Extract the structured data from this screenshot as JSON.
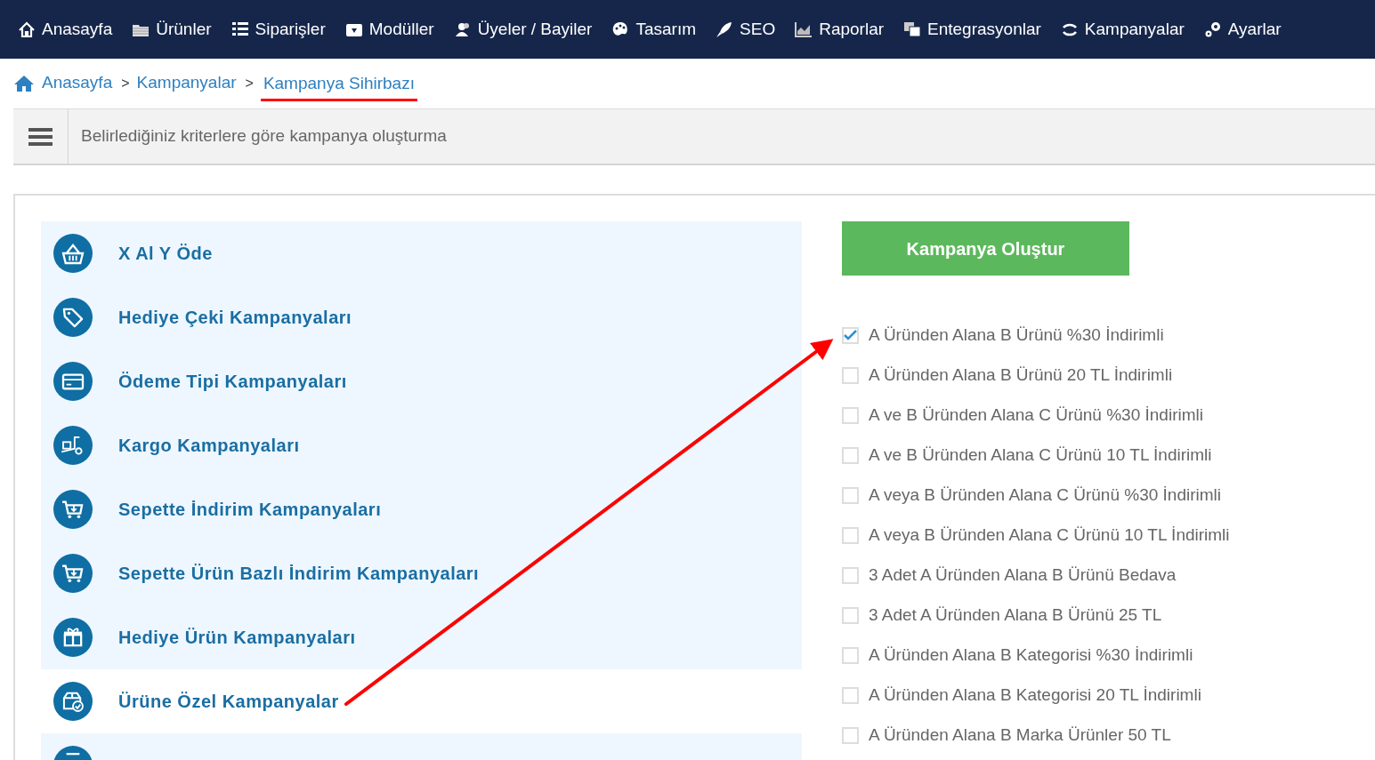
{
  "nav": [
    {
      "label": "Anasayfa"
    },
    {
      "label": "Ürünler"
    },
    {
      "label": "Siparişler"
    },
    {
      "label": "Modüller"
    },
    {
      "label": "Üyeler / Bayiler"
    },
    {
      "label": "Tasarım"
    },
    {
      "label": "SEO"
    },
    {
      "label": "Raporlar"
    },
    {
      "label": "Entegrasyonlar"
    },
    {
      "label": "Kampanyalar"
    },
    {
      "label": "Ayarlar"
    }
  ],
  "breadcrumb": [
    {
      "label": "Anasayfa",
      "underlined": false
    },
    {
      "label": "Kampanyalar",
      "underlined": false
    },
    {
      "label": "Kampanya Sihirbazı",
      "underlined": true
    }
  ],
  "breadcrumb_separator": ">",
  "header": {
    "title": "Belirlediğiniz kriterlere göre kampanya oluşturma"
  },
  "campaign_types": [
    {
      "label": "X Al Y Öde",
      "selected": false
    },
    {
      "label": "Hediye Çeki Kampanyaları",
      "selected": false
    },
    {
      "label": "Ödeme Tipi Kampanyaları",
      "selected": false
    },
    {
      "label": "Kargo Kampanyaları",
      "selected": false
    },
    {
      "label": "Sepette İndirim Kampanyaları",
      "selected": false
    },
    {
      "label": "Sepette Ürün Bazlı İndirim Kampanyaları",
      "selected": false
    },
    {
      "label": "Hediye Ürün Kampanyaları",
      "selected": false
    },
    {
      "label": "Ürüne Özel Kampanyalar",
      "selected": true
    },
    {
      "selected": false
    }
  ],
  "create_button": "Kampanya Oluştur",
  "options": [
    {
      "label": "A Üründen Alana B Ürünü %30 İndirimli",
      "checked": true
    },
    {
      "label": "A Üründen Alana B Ürünü 20 TL İndirimli",
      "checked": false
    },
    {
      "label": "A ve B Üründen Alana C Ürünü %30 İndirimli",
      "checked": false
    },
    {
      "label": "A ve B Üründen Alana C Ürünü 10 TL İndirimli",
      "checked": false
    },
    {
      "label": "A veya B Üründen Alana C Ürünü %30 İndirimli",
      "checked": false
    },
    {
      "label": "A veya B Üründen Alana C Ürünü 10 TL İndirimli",
      "checked": false
    },
    {
      "label": "3 Adet A Üründen Alana B Ürünü Bedava",
      "checked": false
    },
    {
      "label": "3 Adet A Üründen Alana B Ürünü 25 TL",
      "checked": false
    },
    {
      "label": "A Üründen Alana B Kategorisi %30 İndirimli",
      "checked": false
    },
    {
      "label": "A Üründen Alana B Kategorisi 20 TL İndirimli",
      "checked": false
    },
    {
      "label": "A Üründen Alana B Marka Ürünler 50 TL",
      "checked": false
    }
  ]
}
